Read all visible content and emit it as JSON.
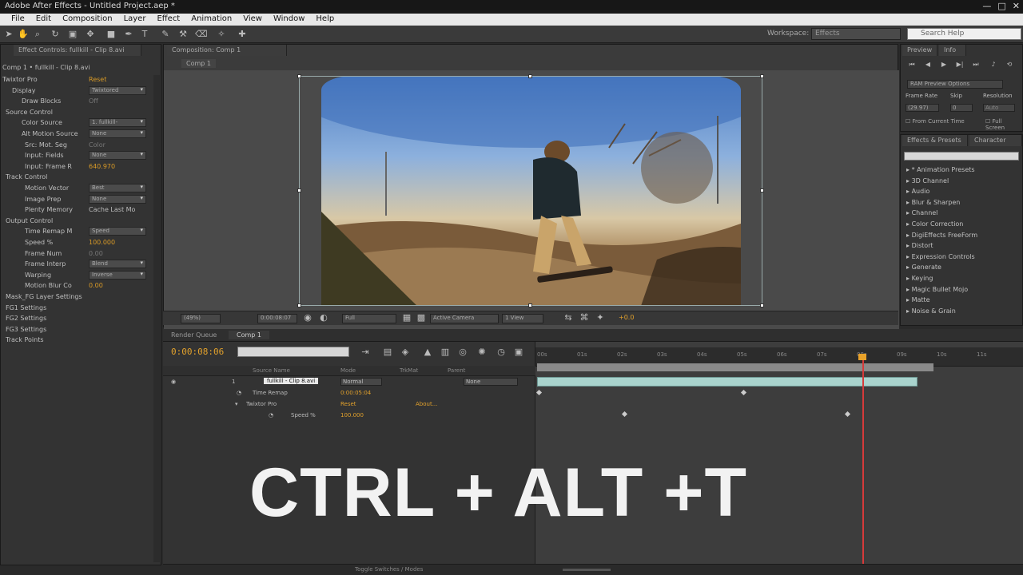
{
  "window": {
    "title": "Adobe After Effects - Untitled Project.aep *"
  },
  "menu": [
    "File",
    "Edit",
    "Composition",
    "Layer",
    "Effect",
    "Animation",
    "View",
    "Window",
    "Help"
  ],
  "toolbar": {
    "workspace_label": "Workspace:",
    "workspace_value": "Effects",
    "search_placeholder": "Search Help"
  },
  "effect_controls": {
    "tab": "Effect Controls: fullkill - Clip 8.avi",
    "breadcrumb": "Comp 1 • fullkill - Clip 8.avi",
    "rows": [
      {
        "label": "Twixtor Pro",
        "value": "Reset",
        "kind": "val",
        "indent": 2
      },
      {
        "label": "Display",
        "value": "Twixtored",
        "kind": "drop",
        "indent": 14
      },
      {
        "label": "Draw Blocks",
        "value": "Off",
        "kind": "dim",
        "indent": 26
      },
      {
        "label": "Source Control",
        "value": "",
        "kind": "none",
        "indent": 6
      },
      {
        "label": "Color Source",
        "value": "1. fullkill-",
        "kind": "drop",
        "indent": 26
      },
      {
        "label": "Alt Motion Source",
        "value": "None",
        "kind": "drop",
        "indent": 26
      },
      {
        "label": "Src: Mot. Seg",
        "value": "Color",
        "kind": "dim",
        "indent": 30
      },
      {
        "label": "Input: Fields",
        "value": "None",
        "kind": "drop",
        "indent": 30
      },
      {
        "label": "Input: Frame R",
        "value": "640.970",
        "kind": "val",
        "indent": 30
      },
      {
        "label": "Track Control",
        "value": "",
        "kind": "none",
        "indent": 6
      },
      {
        "label": "Motion Vector",
        "value": "Best",
        "kind": "drop",
        "indent": 30
      },
      {
        "label": "Image Prep",
        "value": "None",
        "kind": "drop",
        "indent": 30
      },
      {
        "label": "Plenty Memory",
        "value": "Cache Last Mo",
        "kind": "check",
        "indent": 30
      },
      {
        "label": "Output Control",
        "value": "",
        "kind": "none",
        "indent": 6
      },
      {
        "label": "Time Remap M",
        "value": "Speed",
        "kind": "drop",
        "indent": 30
      },
      {
        "label": "Speed %",
        "value": "100.000",
        "kind": "val",
        "indent": 30
      },
      {
        "label": "Frame Num",
        "value": "0.00",
        "kind": "dim",
        "indent": 30
      },
      {
        "label": "Frame Interp",
        "value": "Blend",
        "kind": "drop",
        "indent": 30
      },
      {
        "label": "Warping",
        "value": "Inverse",
        "kind": "drop",
        "indent": 30
      },
      {
        "label": "Motion Blur Co",
        "value": "0.00",
        "kind": "val",
        "indent": 30
      },
      {
        "label": "Mask_FG Layer Settings",
        "value": "",
        "kind": "none",
        "indent": 6
      },
      {
        "label": "FG1 Settings",
        "value": "",
        "kind": "none",
        "indent": 6
      },
      {
        "label": "FG2 Settings",
        "value": "",
        "kind": "none",
        "indent": 6
      },
      {
        "label": "FG3 Settings",
        "value": "",
        "kind": "none",
        "indent": 6
      },
      {
        "label": "Track Points",
        "value": "",
        "kind": "none",
        "indent": 6
      }
    ]
  },
  "composition": {
    "tab": "Composition: Comp 1",
    "subtab": "Comp 1",
    "zoom": "(49%)",
    "timecode": "0:00:08:07",
    "resolution": "Full",
    "camera": "Active Camera",
    "views": "1 View",
    "exposure": "+0.0"
  },
  "preview": {
    "tab": "Preview",
    "tab2": "Info",
    "ram_options": "RAM Preview Options",
    "frame_rate_label": "Frame Rate",
    "skip_label": "Skip",
    "resolution_label": "Resolution",
    "frame_rate_value": "(29.97)",
    "skip_value": "0",
    "resolution_value": "Auto",
    "from_current": "From Current Time",
    "full_screen": "Full Screen"
  },
  "effects_presets": {
    "tab": "Effects & Presets",
    "tab2": "Character",
    "items": [
      "* Animation Presets",
      "3D Channel",
      "Audio",
      "Blur & Sharpen",
      "Channel",
      "Color Correction",
      "DigiEffects FreeForm",
      "Distort",
      "Expression Controls",
      "Generate",
      "Keying",
      "Magic Bullet Mojo",
      "Matte",
      "Noise & Grain"
    ]
  },
  "timeline": {
    "tab_render": "Render Queue",
    "tab_comp": "Comp 1",
    "timecode": "0:00:08:06",
    "columns": {
      "source": "Source Name",
      "mode": "Mode",
      "trkmat": "TrkMat",
      "parent": "Parent"
    },
    "layers": [
      {
        "num": "1",
        "name": "fullkill - Clip 8.avi",
        "mode": "Normal",
        "parent": "None"
      },
      {
        "num": "",
        "name": "Time Remap",
        "mode": "0:00:05:04",
        "parent": ""
      },
      {
        "num": "",
        "name": "Twixtor Pro",
        "mode": "Reset",
        "parent": "About..."
      },
      {
        "num": "",
        "name": "Speed %",
        "mode": "100.000",
        "parent": ""
      }
    ],
    "ruler_labels": [
      "00s",
      "01s",
      "02s",
      "03s",
      "04s",
      "05s",
      "06s",
      "07s",
      "08s",
      "09s",
      "10s",
      "11s"
    ],
    "footer": "Toggle Switches / Modes"
  },
  "overlay": {
    "shortcut": "CTRL + ALT +T"
  },
  "colors": {
    "timecode": "#e2a12c",
    "layer_bar": "#a9d3cd",
    "cti": "#d63a3a",
    "value": "#d99a26"
  }
}
